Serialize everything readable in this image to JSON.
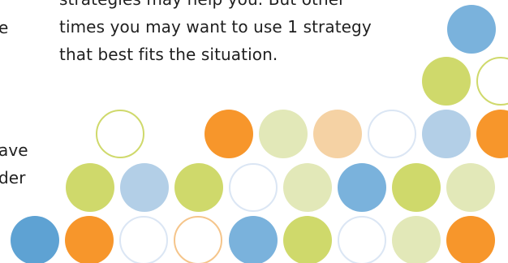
{
  "colors": {
    "text": "#1f1f1f",
    "blue_dark": "#5ea2d3",
    "blue_mid": "#7ab2dc",
    "blue_light": "#b3cfe7",
    "green": "#cfd96b",
    "green_light": "#e2e8b8",
    "orange": "#f7962b",
    "peach": "#f5d2a4",
    "outline_green": "#cfd96b",
    "outline_blue": "#dbe6f4",
    "outline_orange": "#f5c58b"
  },
  "paragraph": {
    "line1": "strategies may help you. But other",
    "line2": "times you may want to use 1 strategy",
    "line3": "that best fits the situation."
  },
  "left_fragments": {
    "frag1": "e",
    "frag2": "ave",
    "frag3": "der"
  },
  "circles": [
    {
      "style": "filled",
      "color": "blue_mid"
    },
    {
      "style": "filled",
      "color": "green"
    },
    {
      "style": "outline",
      "color": "outline_green"
    },
    {
      "style": "outline",
      "color": "outline_green"
    },
    {
      "style": "filled",
      "color": "orange"
    },
    {
      "style": "filled",
      "color": "green_light"
    },
    {
      "style": "filled",
      "color": "peach"
    },
    {
      "style": "outline",
      "color": "outline_blue"
    },
    {
      "style": "filled",
      "color": "blue_light"
    },
    {
      "style": "filled",
      "color": "orange"
    },
    {
      "style": "filled",
      "color": "green"
    },
    {
      "style": "filled",
      "color": "blue_light"
    },
    {
      "style": "filled",
      "color": "green"
    },
    {
      "style": "outline",
      "color": "outline_blue"
    },
    {
      "style": "filled",
      "color": "green_light"
    },
    {
      "style": "filled",
      "color": "blue_mid"
    },
    {
      "style": "filled",
      "color": "green"
    },
    {
      "style": "filled",
      "color": "green_light"
    },
    {
      "style": "filled",
      "color": "blue_dark"
    },
    {
      "style": "filled",
      "color": "orange"
    },
    {
      "style": "outline",
      "color": "outline_blue"
    },
    {
      "style": "outline",
      "color": "outline_orange"
    },
    {
      "style": "filled",
      "color": "blue_mid"
    },
    {
      "style": "filled",
      "color": "green"
    },
    {
      "style": "outline",
      "color": "outline_blue"
    },
    {
      "style": "filled",
      "color": "green_light"
    },
    {
      "style": "filled",
      "color": "orange"
    }
  ]
}
